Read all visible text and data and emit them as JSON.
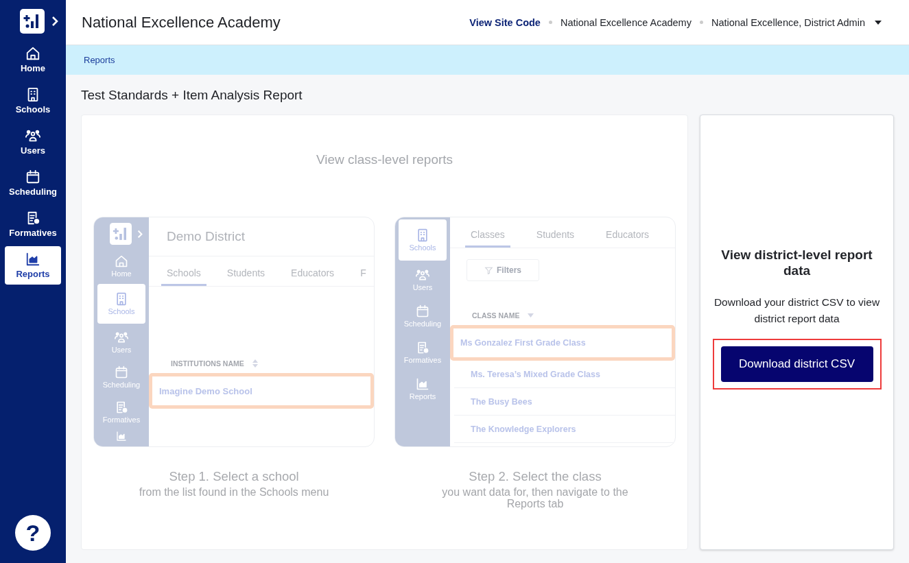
{
  "sidebar": {
    "items": [
      {
        "kind": "home",
        "label": "Home",
        "selected": false
      },
      {
        "kind": "school",
        "label": "Schools",
        "selected": false
      },
      {
        "kind": "users",
        "label": "Users",
        "selected": false
      },
      {
        "kind": "calendar",
        "label": "Scheduling",
        "selected": false
      },
      {
        "kind": "formatives",
        "label": "Formatives",
        "selected": false
      },
      {
        "kind": "reports",
        "label": "Reports",
        "selected": true
      }
    ],
    "help": "?"
  },
  "header": {
    "title": "National Excellence Academy",
    "site_code_link": "View Site Code",
    "school": "National Excellence Academy",
    "user": "National Excellence, District Admin"
  },
  "breadcrumb": [
    "Reports"
  ],
  "page_title": "Test Standards + Item Analysis Report",
  "class_panel": {
    "heading": "View class-level reports",
    "steps": [
      {
        "title": "Step 1. Select a school",
        "text": "from the list found in the Schools menu",
        "preview": {
          "title": "Demo District",
          "nav": [
            {
              "kind": "logo"
            },
            {
              "kind": "home",
              "label": "Home",
              "selected": false
            },
            {
              "kind": "school",
              "label": "Schools",
              "selected": true
            },
            {
              "kind": "users",
              "label": "Users",
              "selected": false
            },
            {
              "kind": "calendar",
              "label": "Scheduling",
              "selected": false
            },
            {
              "kind": "formatives",
              "label": "Formatives",
              "selected": false
            },
            {
              "kind": "reports"
            }
          ],
          "tabs": [
            {
              "label": "Schools",
              "selected": true
            },
            {
              "label": "Students",
              "selected": false
            },
            {
              "label": "Educators",
              "selected": false
            },
            {
              "label": "F",
              "selected": false
            }
          ],
          "column": {
            "label": "INSTITUTIONS NAME",
            "kind": "sortable"
          },
          "rows": [
            {
              "label": "Imagine Demo School",
              "highlighted": true
            }
          ]
        }
      },
      {
        "title": "Step 2. Select the class",
        "text": "you want data for, then navigate to the Reports tab",
        "preview": {
          "filter": "Filters",
          "nav": [
            {
              "kind": "school",
              "label": "Schools",
              "selected": true
            },
            {
              "kind": "users",
              "label": "Users",
              "selected": false
            },
            {
              "kind": "calendar",
              "label": "Scheduling",
              "selected": false
            },
            {
              "kind": "formatives",
              "label": "Formatives",
              "selected": false
            },
            {
              "kind": "reports",
              "label": "Reports",
              "selected": false
            }
          ],
          "tabs": [
            {
              "label": "Classes",
              "selected": true
            },
            {
              "label": "Students",
              "selected": false
            },
            {
              "label": "Educators",
              "selected": false
            }
          ],
          "column": {
            "label": "CLASS NAME",
            "kind": "descending"
          },
          "rows": [
            {
              "label": "Ms Gonzalez First Grade Class",
              "highlighted": true
            },
            {
              "label": "Ms. Teresa’s Mixed Grade Class",
              "highlighted": false
            },
            {
              "label": "The Busy Bees",
              "highlighted": false
            },
            {
              "label": "The Knowledge Explorers",
              "highlighted": false
            }
          ]
        }
      }
    ]
  },
  "district_panel": {
    "heading": "View district-level report data",
    "text_lines": [
      "Download your district CSV to view",
      "district report data"
    ],
    "button": "Download district CSV",
    "button_highlighted": true
  }
}
